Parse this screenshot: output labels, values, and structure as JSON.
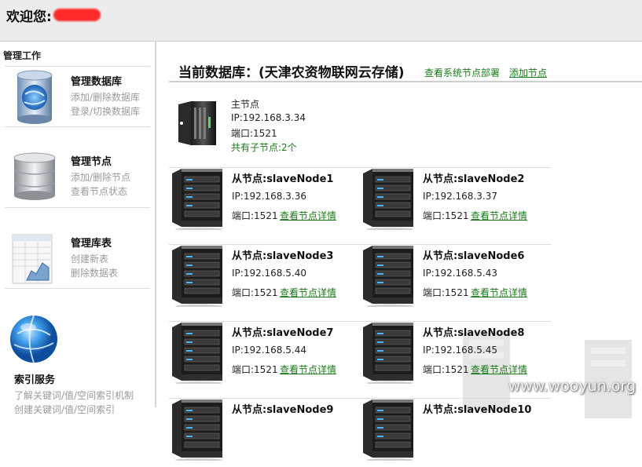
{
  "header": {
    "welcome": "欢迎您:"
  },
  "sidebar": {
    "title": "管理工作",
    "items": [
      {
        "icon": "database-globe-icon",
        "heading": "管理数据库",
        "links": [
          "添加/删除数据库",
          "登录/切换数据库"
        ]
      },
      {
        "icon": "database-stack-icon",
        "heading": "管理节点",
        "links": [
          "添加/删除节点",
          "查看节点状态"
        ]
      },
      {
        "icon": "spreadsheet-chart-icon",
        "heading": "管理库表",
        "links": [
          "创建新表",
          "删除数据表"
        ]
      },
      {
        "icon": "globe-icon",
        "heading": "索引服务",
        "links": [
          "了解关键词/值/空间索引机制",
          "创建关键词/值/空间索引"
        ]
      }
    ]
  },
  "main": {
    "title": "当前数据库：(天津农资物联网云存储)",
    "link_view_deploy": "查看系统节点部署",
    "link_add_node": "添加节点",
    "master": {
      "label": "主节点",
      "ip": "IP:192.168.3.34",
      "port": "端口:1521",
      "children": "共有子节点:2个"
    },
    "nodes": [
      {
        "name": "从节点:slaveNode1",
        "ip": "IP:192.168.3.36",
        "port": "端口:1521",
        "link": "查看节点详情"
      },
      {
        "name": "从节点:slaveNode2",
        "ip": "IP:192.168.3.37",
        "port": "端口:1521",
        "link": "查看节点详情"
      },
      {
        "name": "从节点:slaveNode3",
        "ip": "IP:192.168.5.40",
        "port": "端口:1521",
        "link": "查看节点详情"
      },
      {
        "name": "从节点:slaveNode6",
        "ip": "IP:192.168.5.43",
        "port": "端口:1521",
        "link": "查看节点详情"
      },
      {
        "name": "从节点:slaveNode7",
        "ip": "IP:192.168.5.44",
        "port": "端口:1521",
        "link": "查看节点详情"
      },
      {
        "name": "从节点:slaveNode8",
        "ip": "IP:192.168.5.45",
        "port": "端口:1521",
        "link": "查看节点详情"
      },
      {
        "name": "从节点:slaveNode9",
        "ip": "",
        "port": "",
        "link": ""
      },
      {
        "name": "从节点:slaveNode10",
        "ip": "",
        "port": "",
        "link": ""
      }
    ]
  },
  "watermark": "www.wooyun.org",
  "colors": {
    "link_green": "#1a7a1a",
    "redaction": "#ff2b2b"
  }
}
